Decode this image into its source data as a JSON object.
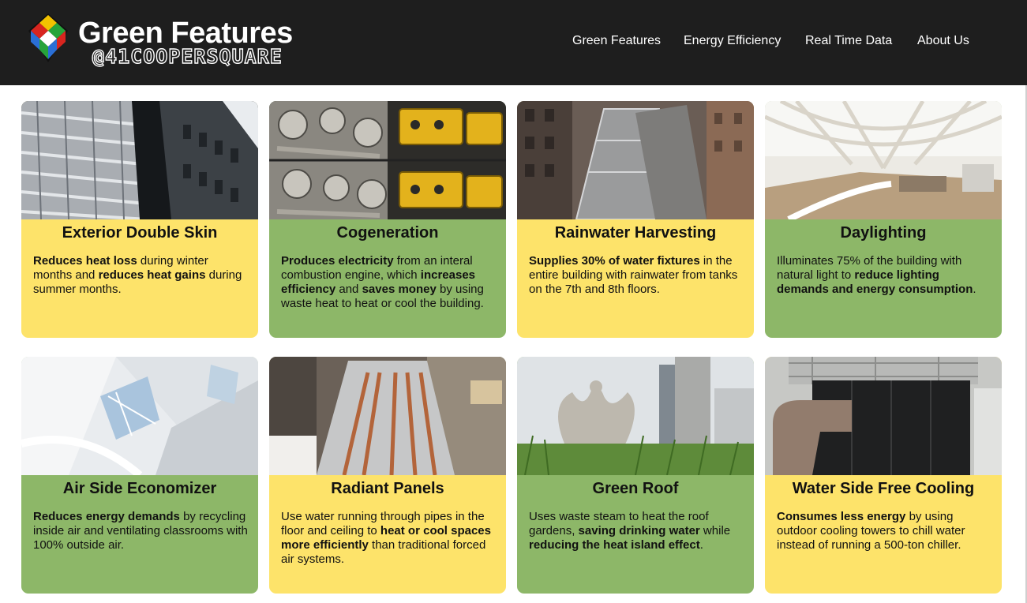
{
  "header": {
    "logo_title": "Green Features",
    "logo_subtitle": "@41COOPERSQUARE",
    "nav": [
      "Green Features",
      "Energy Efficiency",
      "Real Time Data",
      "About Us"
    ]
  },
  "colors": {
    "header_bg": "#1e1e1e",
    "yellow_card": "#fde36a",
    "green_card": "#8db768"
  },
  "cards": [
    {
      "title": "Exterior Double Skin",
      "color": "yellow",
      "photo": "perforated-facade-photo",
      "parts": [
        [
          "Reduces heat loss",
          true
        ],
        [
          " during winter months and ",
          false
        ],
        [
          "reduces heat gains",
          true
        ],
        [
          " during summer months.",
          false
        ]
      ]
    },
    {
      "title": "Cogeneration",
      "color": "green",
      "photo": "engine-photo",
      "parts": [
        [
          "Produces electricity",
          true
        ],
        [
          " from an interal combustion engine, which ",
          false
        ],
        [
          "increases efficiency",
          true
        ],
        [
          " and ",
          false
        ],
        [
          "saves money",
          true
        ],
        [
          " by using waste heat to heat or cool the building.",
          false
        ]
      ]
    },
    {
      "title": "Rainwater Harvesting",
      "color": "yellow",
      "photo": "rooftop-photo",
      "parts": [
        [
          "Supplies 30% of water fixtures",
          true
        ],
        [
          " in the entire building with rainwater from tanks on the 7th and 8th floors.",
          false
        ]
      ]
    },
    {
      "title": "Daylighting",
      "color": "green",
      "photo": "atrium-photo",
      "parts": [
        [
          "Illuminates 75% of the building with natural light to ",
          false
        ],
        [
          "reduce lighting demands and energy consumption",
          true
        ],
        [
          ".",
          false
        ]
      ]
    },
    {
      "title": "Air Side Economizer",
      "color": "green",
      "photo": "white-interior-photo",
      "parts": [
        [
          "Reduces energy demands",
          true
        ],
        [
          " by recycling inside air and ventilating classrooms with 100% outside air.",
          false
        ]
      ]
    },
    {
      "title": "Radiant Panels",
      "color": "yellow",
      "photo": "radiant-pipes-photo",
      "parts": [
        [
          "Use water running through pipes in the floor and ceiling to ",
          false
        ],
        [
          "heat or cool spaces more efficiently",
          true
        ],
        [
          " than traditional forced air systems.",
          false
        ]
      ]
    },
    {
      "title": "Green Roof",
      "color": "green",
      "photo": "eagle-garden-photo",
      "parts": [
        [
          "Uses waste steam to heat the roof gardens, ",
          false
        ],
        [
          "saving drinking water",
          true
        ],
        [
          " while ",
          false
        ],
        [
          "reducing the heat island effect",
          true
        ],
        [
          ".",
          false
        ]
      ]
    },
    {
      "title": "Water Side Free Cooling",
      "color": "yellow",
      "photo": "cooling-tower-photo",
      "parts": [
        [
          "Consumes less energy",
          true
        ],
        [
          " by using outdoor cooling towers to chill water instead of running a 500-ton chiller.",
          false
        ]
      ]
    }
  ]
}
